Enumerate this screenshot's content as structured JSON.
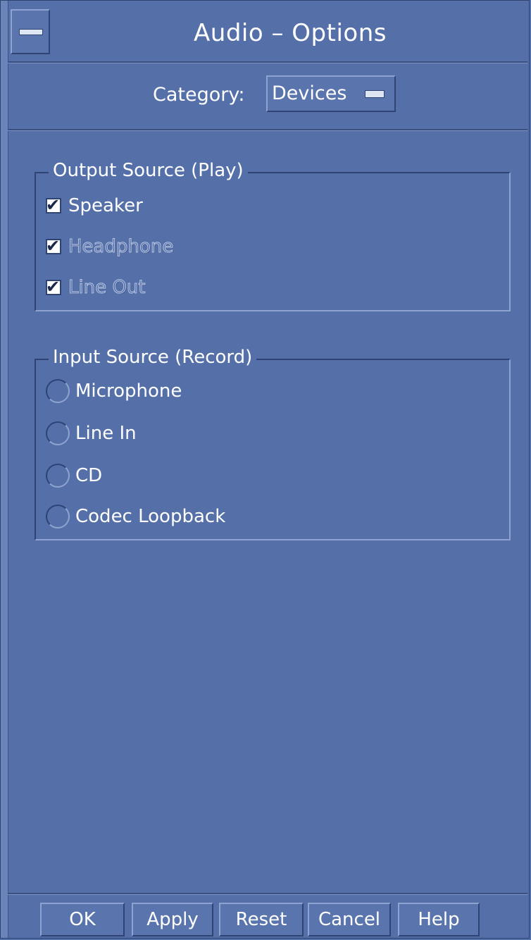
{
  "window": {
    "title": "Audio – Options"
  },
  "category": {
    "label": "Category:",
    "selected": "Devices"
  },
  "output_group": {
    "title": "Output Source (Play)",
    "items": [
      {
        "label": "Speaker",
        "checked": true,
        "enabled": true
      },
      {
        "label": "Headphone",
        "checked": true,
        "enabled": false
      },
      {
        "label": "Line Out",
        "checked": true,
        "enabled": false
      }
    ]
  },
  "input_group": {
    "title": "Input Source (Record)",
    "items": [
      {
        "label": "Microphone",
        "selected": false
      },
      {
        "label": "Line In",
        "selected": false
      },
      {
        "label": "CD",
        "selected": false
      },
      {
        "label": "Codec Loopback",
        "selected": false
      }
    ]
  },
  "buttons": {
    "ok": "OK",
    "apply": "Apply",
    "reset": "Reset",
    "cancel": "Cancel",
    "help": "Help"
  },
  "colors": {
    "background": "#5570a9",
    "shadow": "#2f4374",
    "highlight": "#8ea3cf"
  }
}
